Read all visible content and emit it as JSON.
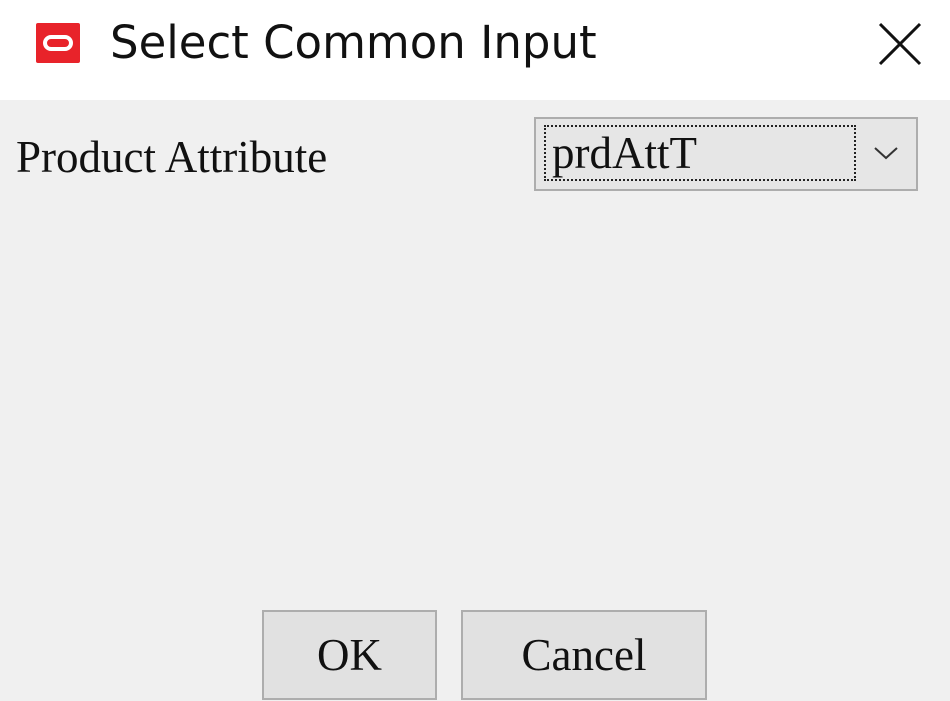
{
  "window": {
    "title": "Select Common Input",
    "app_icon": "oracle-logo-icon",
    "close_icon": "close-icon",
    "accent_color": "#e8232a"
  },
  "form": {
    "label": "Product Attribute",
    "dropdown": {
      "value": "prdAttT",
      "icon": "chevron-down-icon"
    }
  },
  "buttons": {
    "ok_label": "OK",
    "cancel_label": "Cancel"
  }
}
